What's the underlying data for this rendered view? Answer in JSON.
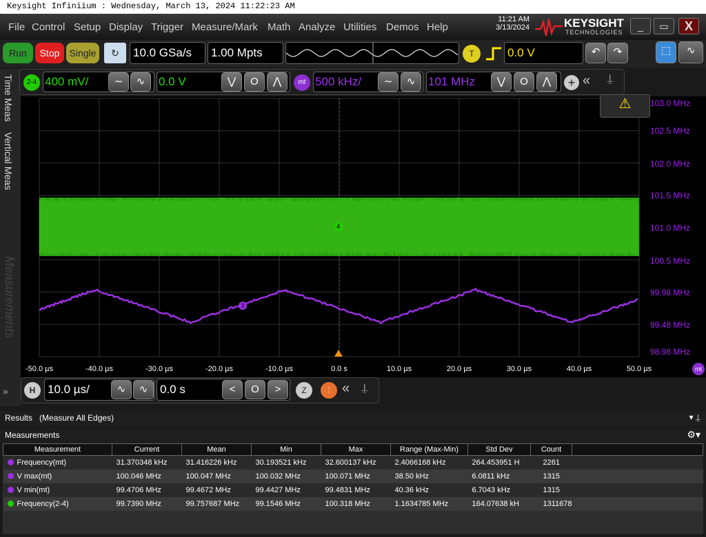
{
  "window": {
    "title": "Keysight Infiniium : Wednesday, March 13, 2024 11:22:23 AM"
  },
  "menu": [
    "File",
    "Control",
    "Setup",
    "Display",
    "Trigger",
    "Measure/Mark",
    "Math",
    "Analyze",
    "Utilities",
    "Demos",
    "Help"
  ],
  "clock": {
    "time": "11:21 AM",
    "date": "3/13/2024"
  },
  "logo": {
    "name": "KEYSIGHT",
    "sub": "TECHNOLOGIES"
  },
  "toolbar": {
    "run": "Run",
    "stop": "Stop",
    "single": "Single",
    "sample_rate": "10.0 GSa/s",
    "memory": "1.00 Mpts",
    "trigger_label": "T",
    "trigger_level": "0.0 V"
  },
  "channels": {
    "ch_label": "2-4",
    "ch_scale": "400 mV/",
    "ch_offset": "0.0 V",
    "math_label": "mt",
    "math_scale": "500 kHz/",
    "math_offset": "101 MHz"
  },
  "side_tabs": [
    "Time Meas",
    "Vertical Meas",
    "Measurements"
  ],
  "plot": {
    "green_color": "#22cc00",
    "purple_color": "#9a30e0",
    "marker_ch": "4",
    "marker_math": "3",
    "right_axis": [
      "103.0 MHz",
      "102.5 MHz",
      "102.0 MHz",
      "101.5 MHz",
      "101.0 MHz",
      "100.5 MHz",
      "99.98 MHz",
      "99.48 MHz",
      "98.98 MHz"
    ],
    "x_axis": [
      "-50.0 µs",
      "-40.0 µs",
      "-30.0 µs",
      "-20.0 µs",
      "-10.0 µs",
      "0.0 s",
      "10.0 µs",
      "20.0 µs",
      "30.0 µs",
      "40.0 µs",
      "50.0 µs"
    ],
    "math_tag": "mt"
  },
  "horizontal": {
    "label": "H",
    "scale": "10.0 µs/",
    "position": "0.0 s"
  },
  "results": {
    "title": "Results",
    "subtitle": "(Measure All Edges)",
    "panel": "Measurements",
    "headers": [
      "Measurement",
      "Current",
      "Mean",
      "Min",
      "Max",
      "Range (Max-Min)",
      "Std Dev",
      "Count"
    ],
    "rows": [
      {
        "n": "1",
        "color": "#9a30e0",
        "cells": [
          "Frequency(mt)",
          "31.370348 kHz",
          "31.416226 kHz",
          "30.193521 kHz",
          "32.600137 kHz",
          "2.4066168 kHz",
          "264.453951 H",
          "2261"
        ]
      },
      {
        "n": "2",
        "color": "#9a30e0",
        "cells": [
          "V max(mt)",
          "100.046 MHz",
          "100.047 MHz",
          "100.032 MHz",
          "100.071 MHz",
          "38.50 kHz",
          "6.0811 kHz",
          "1315"
        ]
      },
      {
        "n": "3",
        "color": "#9a30e0",
        "cells": [
          "V min(mt)",
          "99.4706 MHz",
          "99.4672 MHz",
          "99.4427 MHz",
          "99.4831 MHz",
          "40.36 kHz",
          "6.7043 kHz",
          "1315"
        ]
      },
      {
        "n": "4",
        "color": "#22cc00",
        "cells": [
          "Frequency(2-4)",
          "99.7390 MHz",
          "99.757687 MHz",
          "99.1546 MHz",
          "100.318 MHz",
          "1.1634785 MHz",
          "164.07638 kH",
          "1311678"
        ]
      }
    ]
  }
}
